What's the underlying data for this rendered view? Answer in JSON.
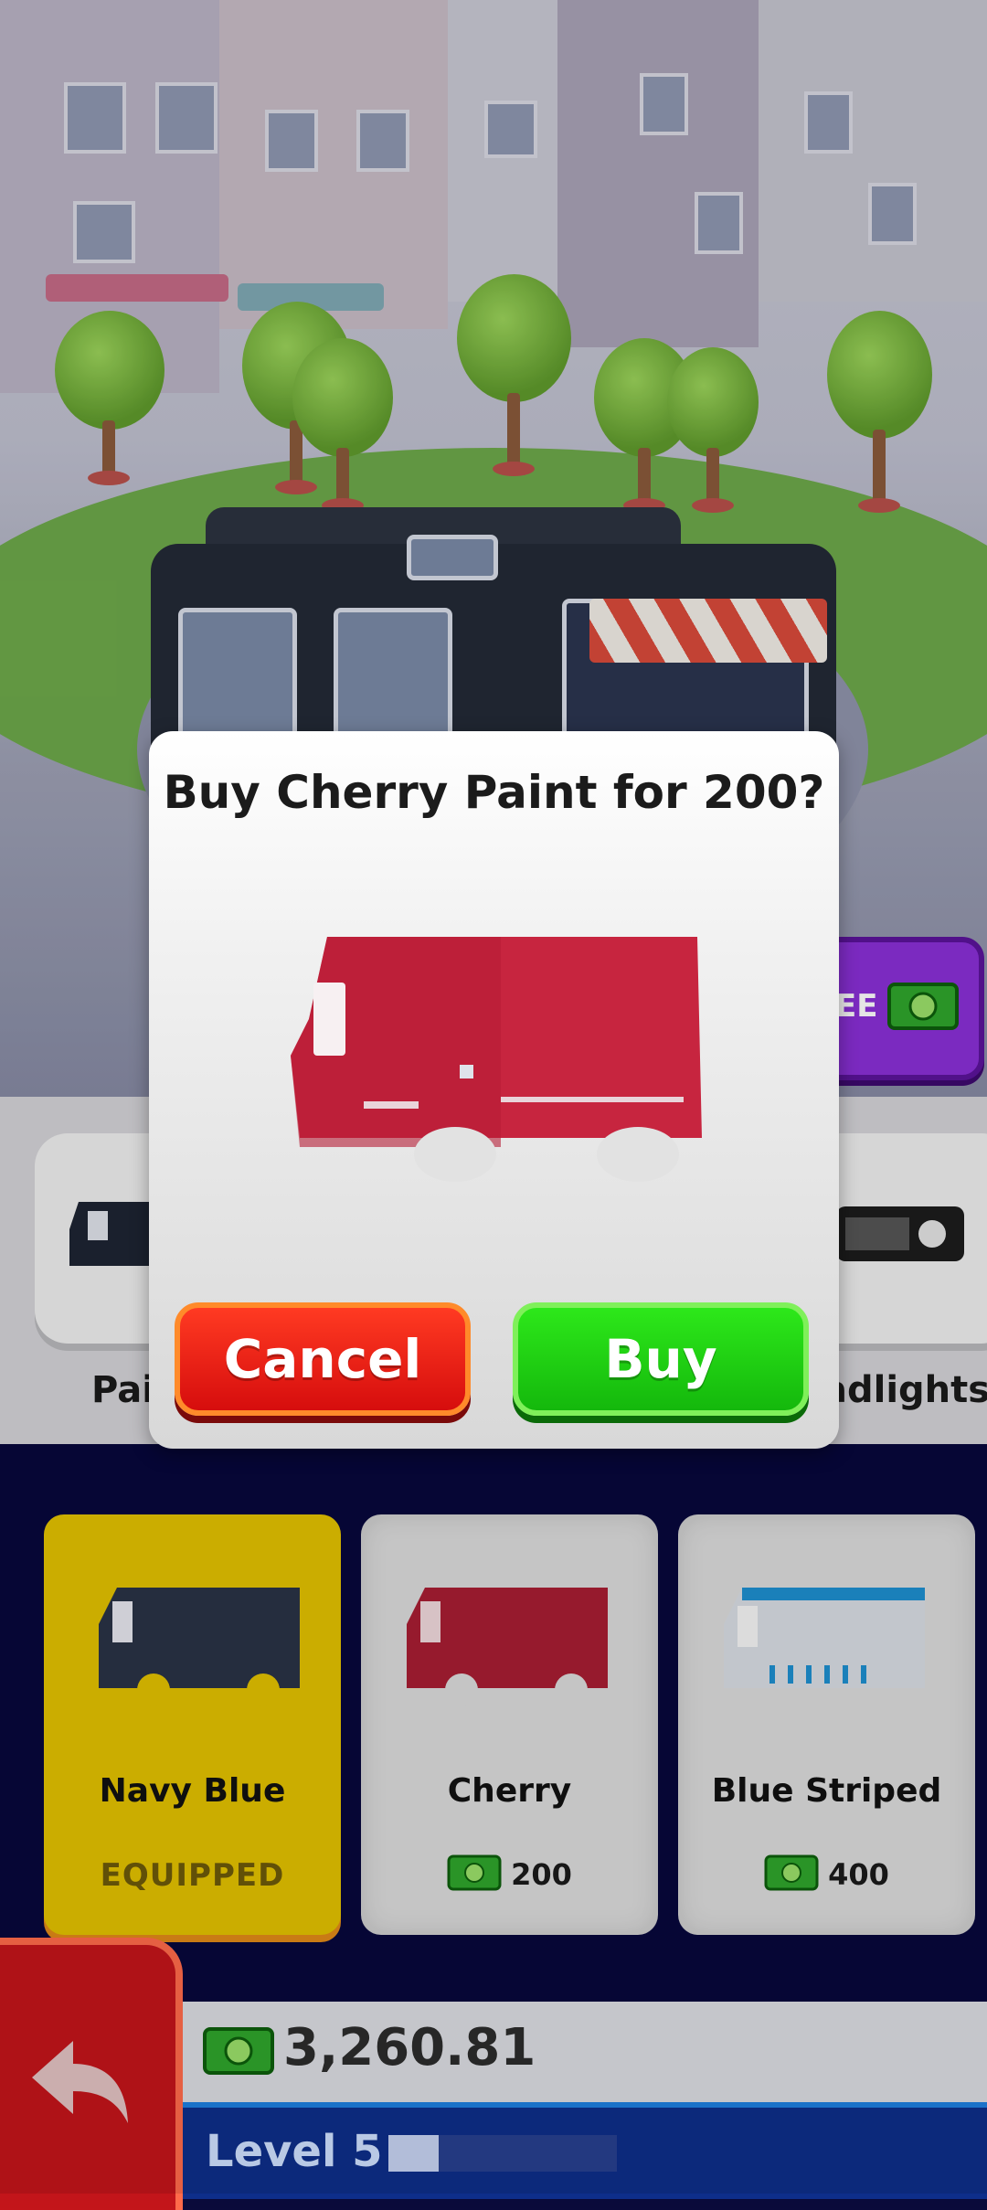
{
  "dialog": {
    "title": "Buy Cherry Paint for 200?",
    "cancel_label": "Cancel",
    "buy_label": "Buy",
    "preview_color": "#c7253f"
  },
  "shop_button": {
    "label_fragment": "EE",
    "icon": "cash-icon",
    "color": "#8a2fd6"
  },
  "categories": [
    {
      "label": "Pai",
      "icon": "truck-body-icon"
    },
    {
      "label": "adlights",
      "icon": "headlights-icon"
    }
  ],
  "paints": [
    {
      "name": "Navy Blue",
      "status": "EQUIPPED",
      "color": "#2a3346"
    },
    {
      "name": "Cherry",
      "price": "200",
      "color": "#c7253f"
    },
    {
      "name": "Blue Striped",
      "price": "400",
      "color": "#dfe3ea"
    }
  ],
  "wallet": {
    "cash": "3,260.81",
    "icon": "cash-icon"
  },
  "level": {
    "label": "Level 5",
    "progress": 0.22
  },
  "back_button": {
    "icon": "back-arrow-icon"
  },
  "colors": {
    "accent_green": "#14b80c",
    "accent_red": "#d60d0d",
    "panel_bg": "#07073b",
    "equipped": "#e2c100"
  }
}
